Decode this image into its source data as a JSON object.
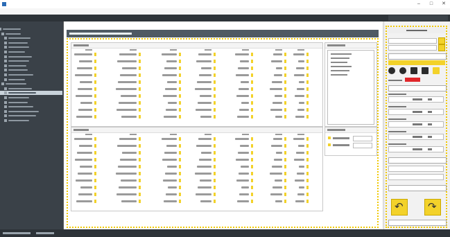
{
  "window": {
    "title": "",
    "controls": {
      "minimize": "–",
      "maximize": "□",
      "close": "✕"
    }
  },
  "menubar": {
    "items": [
      "",
      ""
    ]
  },
  "breadcrumb": {
    "text": "",
    "panel_label_1": "",
    "panel_label_2": ""
  },
  "sidebar": {
    "item_count": 21,
    "active_index": 14
  },
  "main": {
    "header_title": "",
    "panel_top": {
      "title": "",
      "row_count": 10
    },
    "panel_bottom": {
      "title": "",
      "row_count": 10
    },
    "side_list": {
      "title": "",
      "items": [
        "",
        "",
        "",
        "",
        "",
        ""
      ]
    },
    "side_options": {
      "title": "",
      "options": [
        {
          "label": "",
          "value": ""
        },
        {
          "label": "",
          "value": ""
        }
      ]
    }
  },
  "right_panel": {
    "title": "",
    "fields": [
      "",
      ""
    ],
    "select_value": "",
    "band_title": "",
    "tool_icons": [
      "circle-icon",
      "circle-icon",
      "square-icon",
      "square-icon",
      "square-icon"
    ],
    "accent": "#f3d22a",
    "alert_color": "#e0262a",
    "inputs": [
      {
        "label": "",
        "value": "",
        "unit": ""
      },
      {
        "label": "",
        "value": "",
        "unit": ""
      },
      {
        "label": "",
        "value": "",
        "unit": ""
      },
      {
        "label": "",
        "value": "",
        "unit": ""
      },
      {
        "label": "",
        "value": "",
        "unit": ""
      }
    ],
    "undo_icon": "undo-icon",
    "redo_icon": "redo-icon"
  },
  "statusbar": {
    "text": ""
  }
}
